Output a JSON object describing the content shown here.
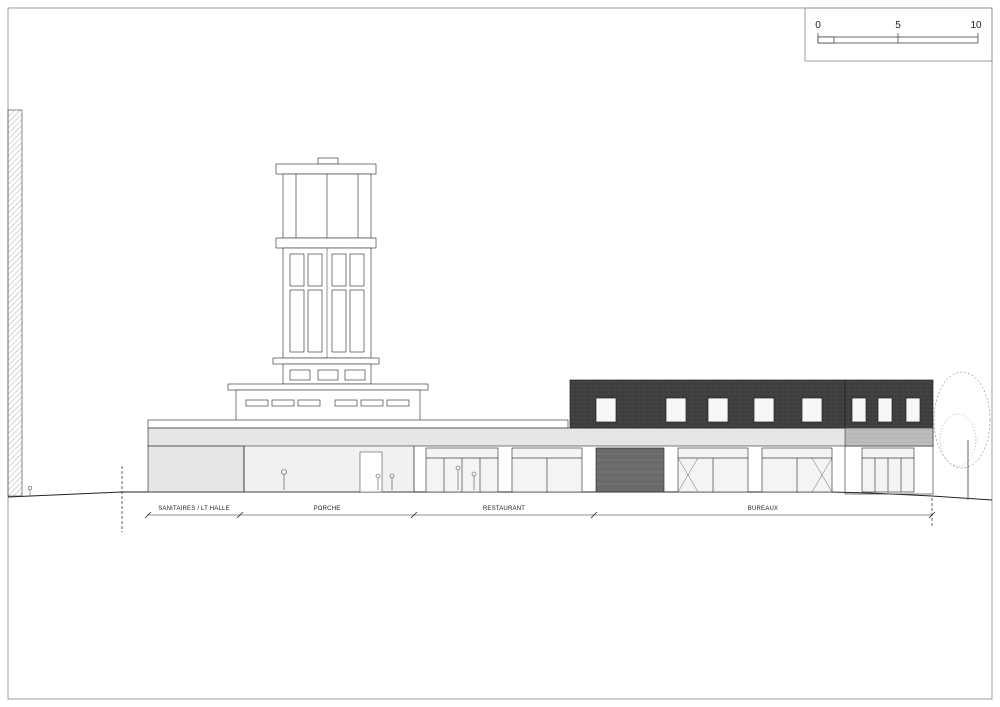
{
  "scale_bar": {
    "ticks": [
      "0",
      "5",
      "10"
    ],
    "values": [
      0,
      5,
      10
    ]
  },
  "zones": [
    {
      "label": "SANITAIRES / LT HALLE"
    },
    {
      "label": "PORCHE"
    },
    {
      "label": "RESTAURANT"
    },
    {
      "label": "BUREAUX"
    }
  ],
  "colors": {
    "line": "#333333",
    "frame": "#888888",
    "brick": "#3a3a3a",
    "cladding": "#707070",
    "glass": "#f4f4f4"
  }
}
